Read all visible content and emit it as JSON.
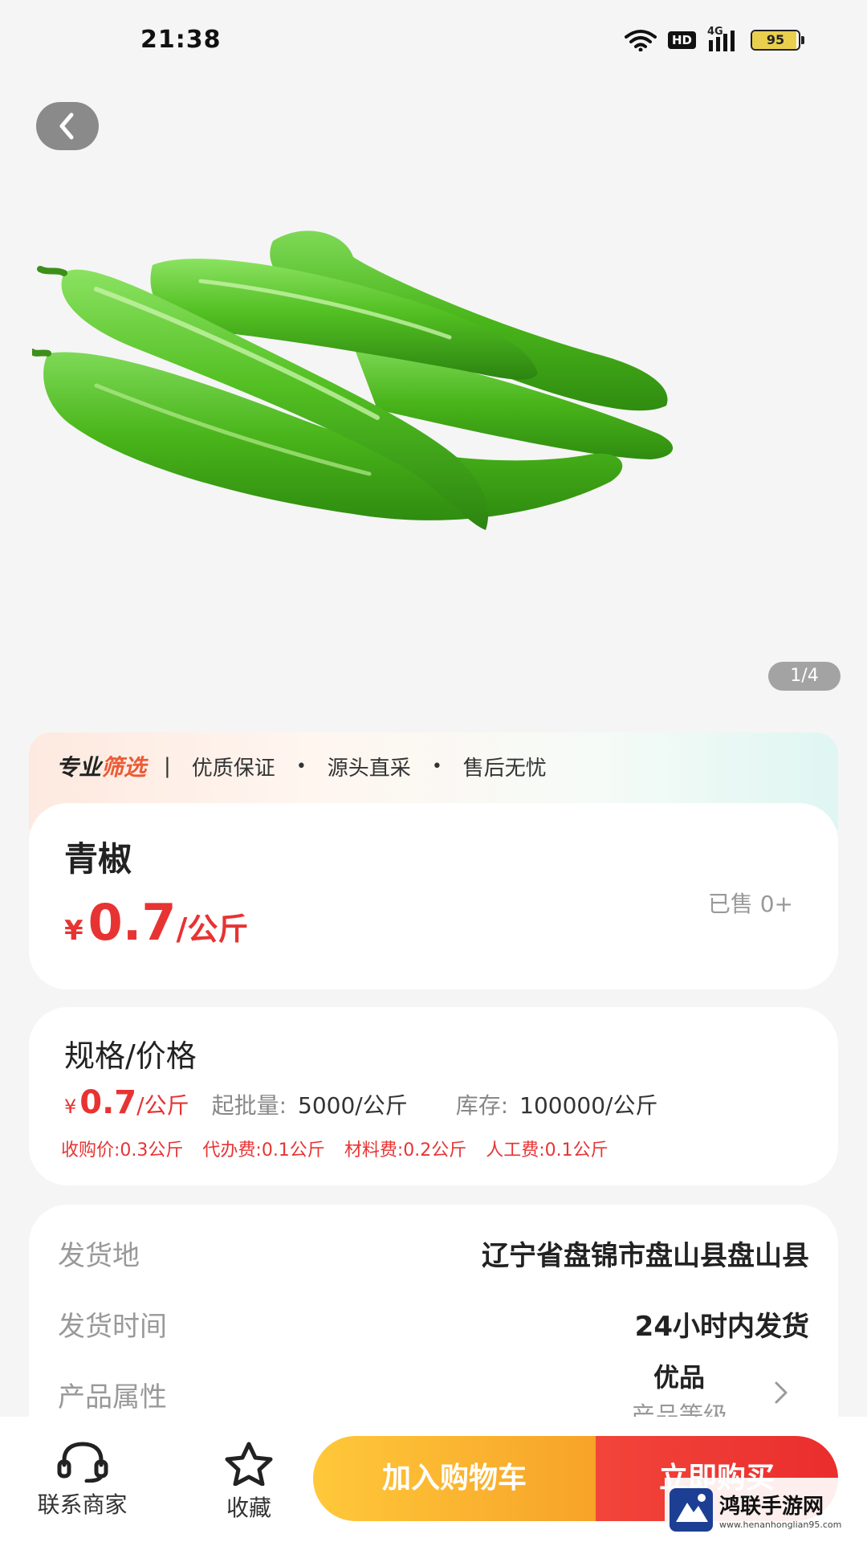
{
  "status_bar": {
    "time": "21:38",
    "network": "4G",
    "hd_label": "HD",
    "battery_level": "95",
    "battery_fraction": 0.95
  },
  "gallery": {
    "back_icon": "chevron-left-icon",
    "image_subject": "green peppers product photo",
    "counter": "1/4"
  },
  "promo": {
    "title": "专业",
    "title_highlight": "筛选",
    "separator": "|",
    "bullet": "•",
    "items": [
      "优质保证",
      "源头直采",
      "售后无忧"
    ]
  },
  "product": {
    "name": "青椒",
    "currency": "¥",
    "price": "0.7",
    "unit": "/公斤",
    "sold": "已售 0+"
  },
  "spec": {
    "title": "规格/价格",
    "currency": "¥",
    "price": "0.7",
    "unit": "/公斤",
    "min_order_label": "起批量:",
    "min_order_value": "5000/公斤",
    "stock_label": "库存:",
    "stock_value": "100000/公斤",
    "fees": [
      "收购价:0.3公斤",
      "代办费:0.1公斤",
      "材料费:0.2公斤",
      "人工费:0.1公斤"
    ]
  },
  "info": {
    "origin_label": "发货地",
    "origin_value": "辽宁省盘锦市盘山县盘山县",
    "ship_time_label": "发货时间",
    "ship_time_value": "24小时内发货",
    "attr_label": "产品属性",
    "attr_value": "优品",
    "attr_sub": "产品等级"
  },
  "bottom_bar": {
    "contact_label": "联系商家",
    "favorite_label": "收藏",
    "add_to_cart": "加入购物车",
    "buy_now": "立即购买"
  },
  "watermark": {
    "name": "鸿联手游网",
    "url": "www.henanhonglian95.com"
  },
  "colors": {
    "price_red": "#e83333",
    "cart_orange": "#f7a328",
    "buy_red": "#ea2d2d",
    "pepper_green": "#4caf1e"
  }
}
